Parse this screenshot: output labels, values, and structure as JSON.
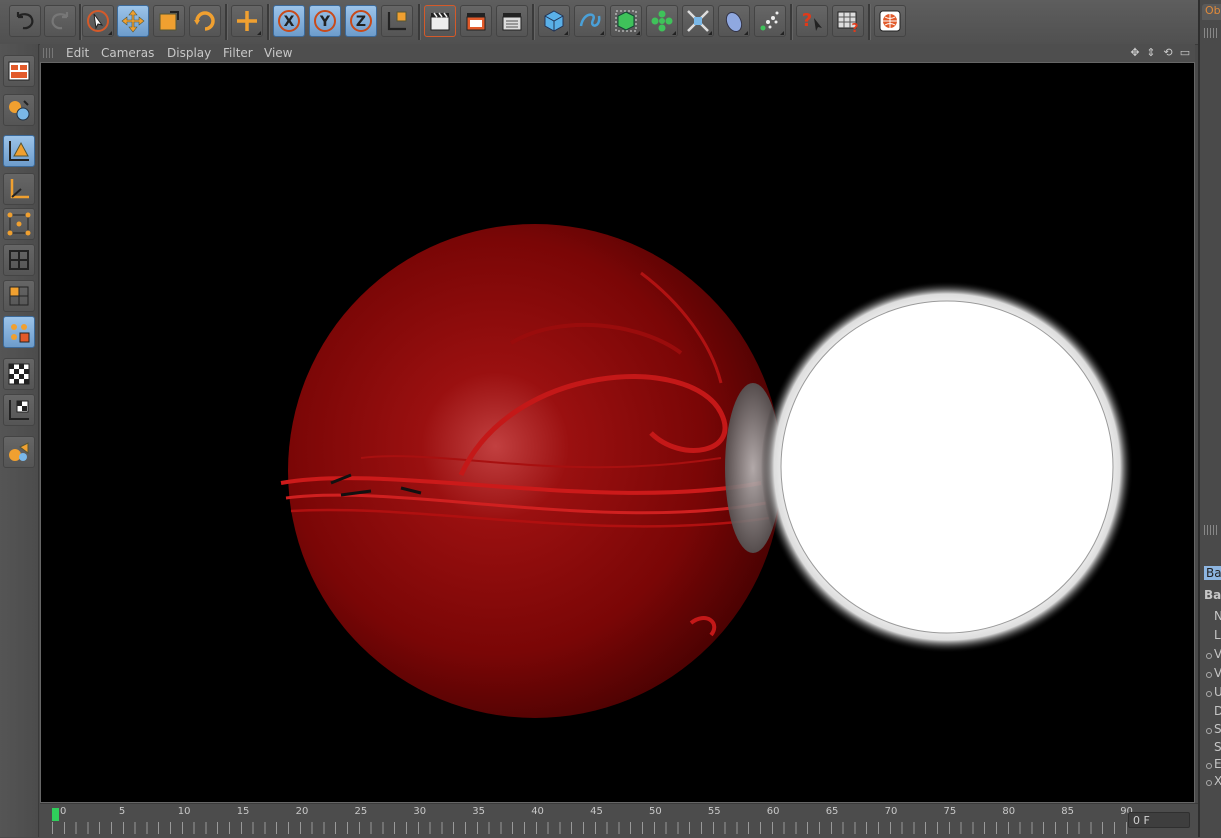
{
  "viewport_menu": {
    "edit": "Edit",
    "cameras": "Cameras",
    "display": "Display",
    "filter": "Filter",
    "view": "View"
  },
  "toolbar_icons": [
    "undo-icon",
    "redo-icon",
    "live-selection-icon",
    "move-icon",
    "scale-icon",
    "rotate-icon",
    "add-object-icon",
    "x-axis-lock-icon",
    "y-axis-lock-icon",
    "z-axis-lock-icon",
    "coordinate-system-icon",
    "render-view-icon",
    "render-picture-viewer-icon",
    "render-settings-icon",
    "cube-primitive-icon",
    "spline-icon",
    "nurbs-icon",
    "array-icon",
    "deformer-icon",
    "scene-icon",
    "particle-icon",
    "help-icon",
    "content-browser-icon",
    "online-icon"
  ],
  "left_toolbar_icons": [
    "layout-icon",
    "object-mode-icon",
    "model-mode-icon",
    "axis-mode-icon",
    "points-mode-icon",
    "edges-mode-icon",
    "polygons-mode-icon",
    "uvw-mode-icon",
    "texture-mode-icon",
    "workplane-icon",
    "sculpt-icon"
  ],
  "timeline": {
    "labels": [
      "0",
      "5",
      "10",
      "15",
      "20",
      "25",
      "30",
      "35",
      "40",
      "45",
      "50",
      "55",
      "60",
      "65",
      "70",
      "75",
      "80",
      "85",
      "90"
    ],
    "current_frame": "0 F"
  },
  "right_panel": {
    "tab": "Ob",
    "attr_tab": "Ba",
    "attr_header": "Ba",
    "rows": [
      "N",
      "L",
      "V",
      "V",
      "U",
      "D",
      "S",
      "S",
      "E",
      "X"
    ]
  },
  "colors": {
    "active_button": "#8db5e0",
    "accent_orange": "#f0a030",
    "sphere_red": "#8a0808",
    "frame_marker": "#2fcf5b"
  }
}
